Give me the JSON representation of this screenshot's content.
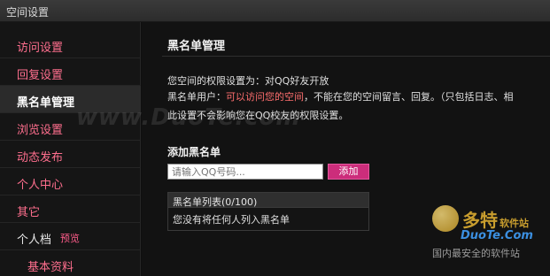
{
  "window": {
    "title": "空间设置"
  },
  "sidebar": {
    "items": [
      {
        "label": "访问设置",
        "state": "link"
      },
      {
        "label": "回复设置",
        "state": "link"
      },
      {
        "label": "黑名单管理",
        "state": "active"
      },
      {
        "label": "浏览设置",
        "state": "link"
      },
      {
        "label": "动态发布",
        "state": "link"
      },
      {
        "label": "个人中心",
        "state": "link"
      },
      {
        "label": "其它",
        "state": "link"
      },
      {
        "label": "个人档",
        "state": "plain",
        "preview_label": "预览"
      },
      {
        "label": "基本资料",
        "state": "sub"
      }
    ]
  },
  "main": {
    "section_title": "黑名单管理",
    "permission_text": "您空间的权限设置为：对QQ好友开放",
    "blacklist_user_prefix": "黑名单用户：",
    "blacklist_user_highlight": "可以访问您的空间",
    "blacklist_user_suffix": "，不能在您的空间留言、回复。（只包括日志、相",
    "note_text": "此设置不会影响您在QQ校友的权限设置。",
    "add_title": "添加黑名单",
    "input_placeholder": "请输入QQ号码...",
    "add_button_label": "添加",
    "list_header": "黑名单列表(0/100)",
    "list_empty": "您没有将任何人列入黑名单"
  },
  "watermark": {
    "text": "www.DuoTe.com"
  },
  "logo": {
    "name": "多特",
    "name_suffix": "软件站",
    "url": "DuoTe.Com",
    "tagline": "国内最安全的软件站"
  },
  "colors": {
    "link": "#ff6f8e",
    "accent": "#cc2d7b",
    "highlight_text": "#ff6f6f",
    "background": "#0f0f0f"
  }
}
